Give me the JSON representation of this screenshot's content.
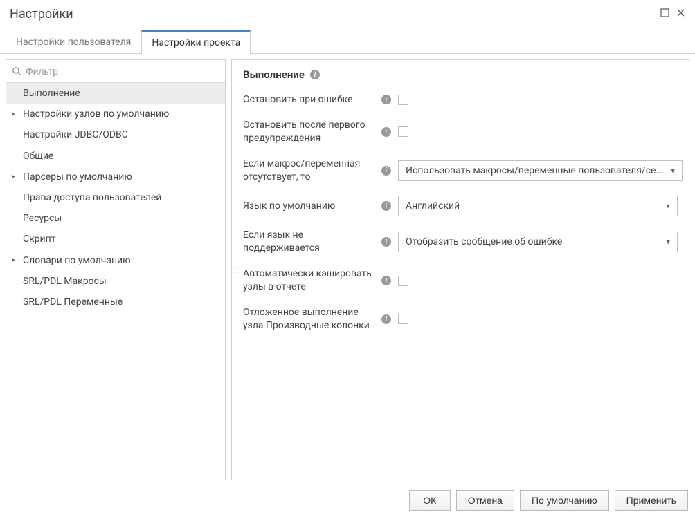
{
  "window": {
    "title": "Настройки"
  },
  "tabs": [
    {
      "label": "Настройки пользователя",
      "active": false
    },
    {
      "label": "Настройки проекта",
      "active": true
    }
  ],
  "sidebar": {
    "filter_placeholder": "Фильтр",
    "items": [
      {
        "label": "Выполнение",
        "selected": true,
        "expandable": false
      },
      {
        "label": "Настройки узлов по умолчанию",
        "selected": false,
        "expandable": true
      },
      {
        "label": "Настройки JDBC/ODBC",
        "selected": false,
        "expandable": false
      },
      {
        "label": "Общие",
        "selected": false,
        "expandable": false
      },
      {
        "label": "Парсеры по умолчанию",
        "selected": false,
        "expandable": true
      },
      {
        "label": "Права доступа пользователей",
        "selected": false,
        "expandable": false
      },
      {
        "label": "Ресурсы",
        "selected": false,
        "expandable": false
      },
      {
        "label": "Скрипт",
        "selected": false,
        "expandable": false
      },
      {
        "label": "Словари по умолчанию",
        "selected": false,
        "expandable": true
      },
      {
        "label": "SRL/PDL Макросы",
        "selected": false,
        "expandable": false
      },
      {
        "label": "SRL/PDL Переменные",
        "selected": false,
        "expandable": false
      }
    ]
  },
  "content": {
    "title": "Выполнение",
    "rows": [
      {
        "label": "Остановить при ошибке",
        "type": "checkbox",
        "checked": false
      },
      {
        "label": "Остановить после первого предупреждения",
        "type": "checkbox",
        "checked": false
      },
      {
        "label": "Если макрос/переменная отсутствует, то",
        "type": "select",
        "value": "Использовать макросы/переменные пользователя/се…"
      },
      {
        "label": "Язык по умолчанию",
        "type": "select",
        "value": "Английский"
      },
      {
        "label": "Если язык не поддерживается",
        "type": "select",
        "value": "Отобразить сообщение об ошибке"
      },
      {
        "label": "Автоматически кэшировать узлы в отчете",
        "type": "checkbox",
        "checked": false
      },
      {
        "label": "Отложенное выполнение узла Производные колонки",
        "type": "checkbox",
        "checked": false
      }
    ]
  },
  "footer": {
    "ok": "ОК",
    "cancel": "Отмена",
    "default": "По умолчанию",
    "apply": "Применить"
  }
}
